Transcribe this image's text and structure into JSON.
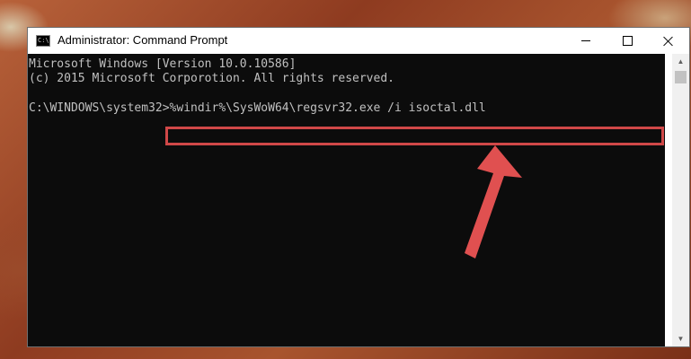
{
  "window": {
    "title": "Administrator: Command Prompt"
  },
  "console": {
    "lines": [
      "Microsoft Windows [Version 10.0.10586]",
      "(c) 2015 Microsoft Corporotion. All rights reserved."
    ],
    "prompt": "C:\\WINDOWS\\system32>",
    "command": "%windir%\\SysWoW64\\regsvr32.exe /i isoctal.dll"
  },
  "colors": {
    "console_bg": "#0c0c0c",
    "console_text": "#c0c0c0",
    "highlight": "#d04848",
    "arrow": "#e05050"
  },
  "icons": {
    "app": "cmd-icon",
    "minimize": "minimize-icon",
    "maximize": "maximize-icon",
    "close": "close-icon",
    "scroll_up": "scroll-up-icon",
    "scroll_down": "scroll-down-icon"
  }
}
